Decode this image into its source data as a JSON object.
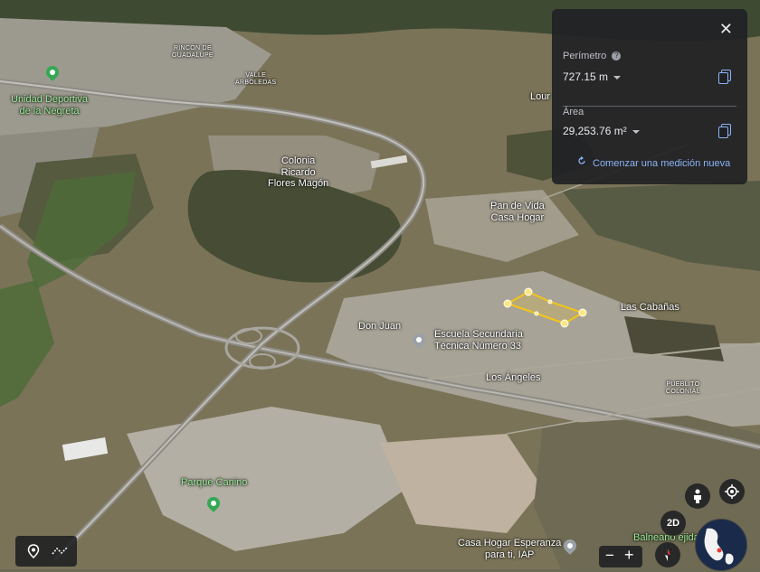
{
  "map": {
    "places": {
      "rincon": "RINCÓN DE\nGUADALUPE",
      "valle": "VALLE\nARBOLEDAS",
      "unidad": "Unidad Deportiva\nde la Negreta",
      "colonia": "Colonia\nRicardo\nFlores Magón",
      "pan": "Pan de Vida\nCasa Hogar",
      "lour": "Lour",
      "cabanas": "Las Cabañas",
      "donjuan": "Don Juan",
      "escuela": "Escuela Secundaria\nTécnica Número 33",
      "angeles": "Los Ángeles",
      "pueblito": "PUEBLITO\nCOLONIAL",
      "parque": "Parque Canino",
      "casahogar": "Casa Hogar Esperanza\npara ti, IAP",
      "balneario": "Balneario ejidal\nRo"
    },
    "colors": {
      "polygon": "#f5c518",
      "pin_green": "#34a853",
      "pin_gray": "#9aa0a6"
    }
  },
  "measure": {
    "perimeter_label": "Perímetro",
    "perimeter_value": "727.15 m",
    "area_label": "Área",
    "area_value": "29,253.76 m²",
    "new_measure": "Comenzar una medición nueva",
    "icons": {
      "close": "close-icon",
      "help": "help-icon",
      "copy": "copy-icon",
      "refresh": "refresh-icon"
    }
  },
  "controls": {
    "view_2d": "2D",
    "zoom_in": "+",
    "zoom_out": "−",
    "icons": [
      "location-pin-icon",
      "path-icon",
      "pegman-icon",
      "my-location-icon",
      "compass-icon",
      "globe-icon"
    ]
  }
}
